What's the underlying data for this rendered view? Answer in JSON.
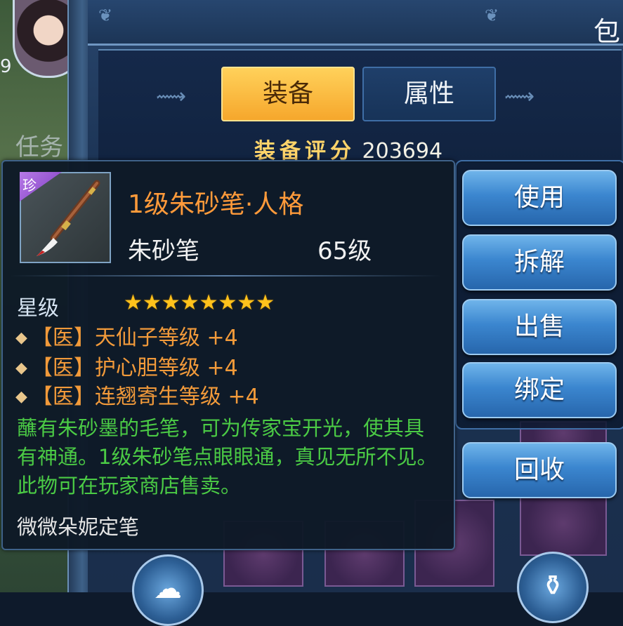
{
  "hud": {
    "level": "9",
    "task_label": "任务"
  },
  "bag": {
    "title": "包",
    "tabs": [
      "装备",
      "属性"
    ],
    "score_label": "装备评分",
    "score_value": "203694"
  },
  "tooltip": {
    "rarity": "珍",
    "name": "1级朱砂笔·人格",
    "type": "朱砂笔",
    "level": "65级",
    "star_label": "星级",
    "stars": "★★★★★★★★",
    "attributes": [
      "【医】天仙子等级 +4",
      "【医】护心胆等级 +4",
      "【医】连翘寄生等级 +4"
    ],
    "description": "蘸有朱砂墨的毛笔，可为传家宝开光，使其具有神通。1级朱砂笔点眼眼通，真见无所不见。此物可在玩家商店售卖。",
    "signature": "微微朵妮定笔"
  },
  "actions": [
    "使用",
    "拆解",
    "出售",
    "绑定",
    "回收"
  ],
  "colors": {
    "item_name": "#ff9a3a",
    "attribute": "#f29a3a",
    "description": "#4bcb45",
    "active_tab": "#f6a72c",
    "button": "#3b86cf"
  }
}
